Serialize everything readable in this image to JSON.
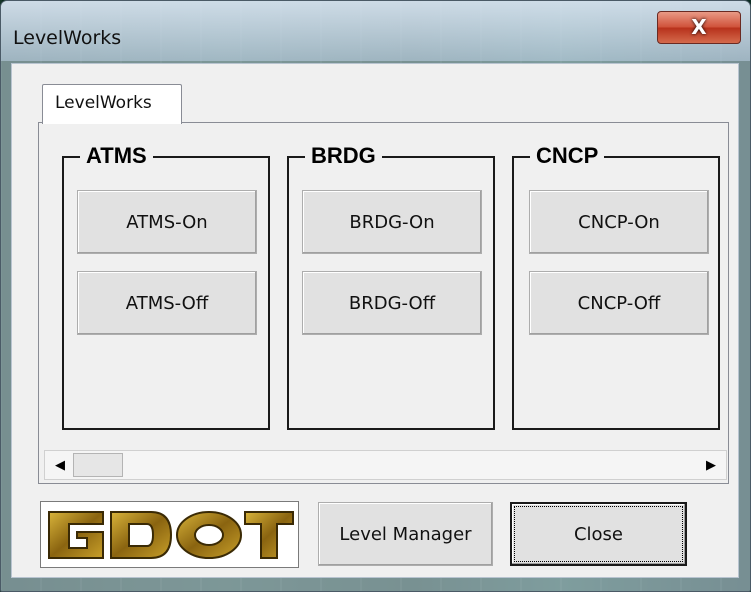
{
  "window": {
    "title": "LevelWorks",
    "close_symbol": "X"
  },
  "tabs": [
    {
      "label": "LevelWorks",
      "selected": true
    }
  ],
  "groups": [
    {
      "label": "ATMS",
      "on_label": "ATMS-On",
      "off_label": "ATMS-Off"
    },
    {
      "label": "BRDG",
      "on_label": "BRDG-On",
      "off_label": "BRDG-Off"
    },
    {
      "label": "CNCP",
      "on_label": "CNCP-On",
      "off_label": "CNCP-Off"
    }
  ],
  "scrollbar": {
    "left_arrow": "◀",
    "right_arrow": "▶"
  },
  "logo": {
    "text": "GDOT"
  },
  "footer": {
    "level_manager_label": "Level Manager",
    "close_label": "Close"
  },
  "colors": {
    "logo_gold": "#b08a1c",
    "logo_dark": "#3a2a05",
    "close_red": "#c8402a"
  }
}
